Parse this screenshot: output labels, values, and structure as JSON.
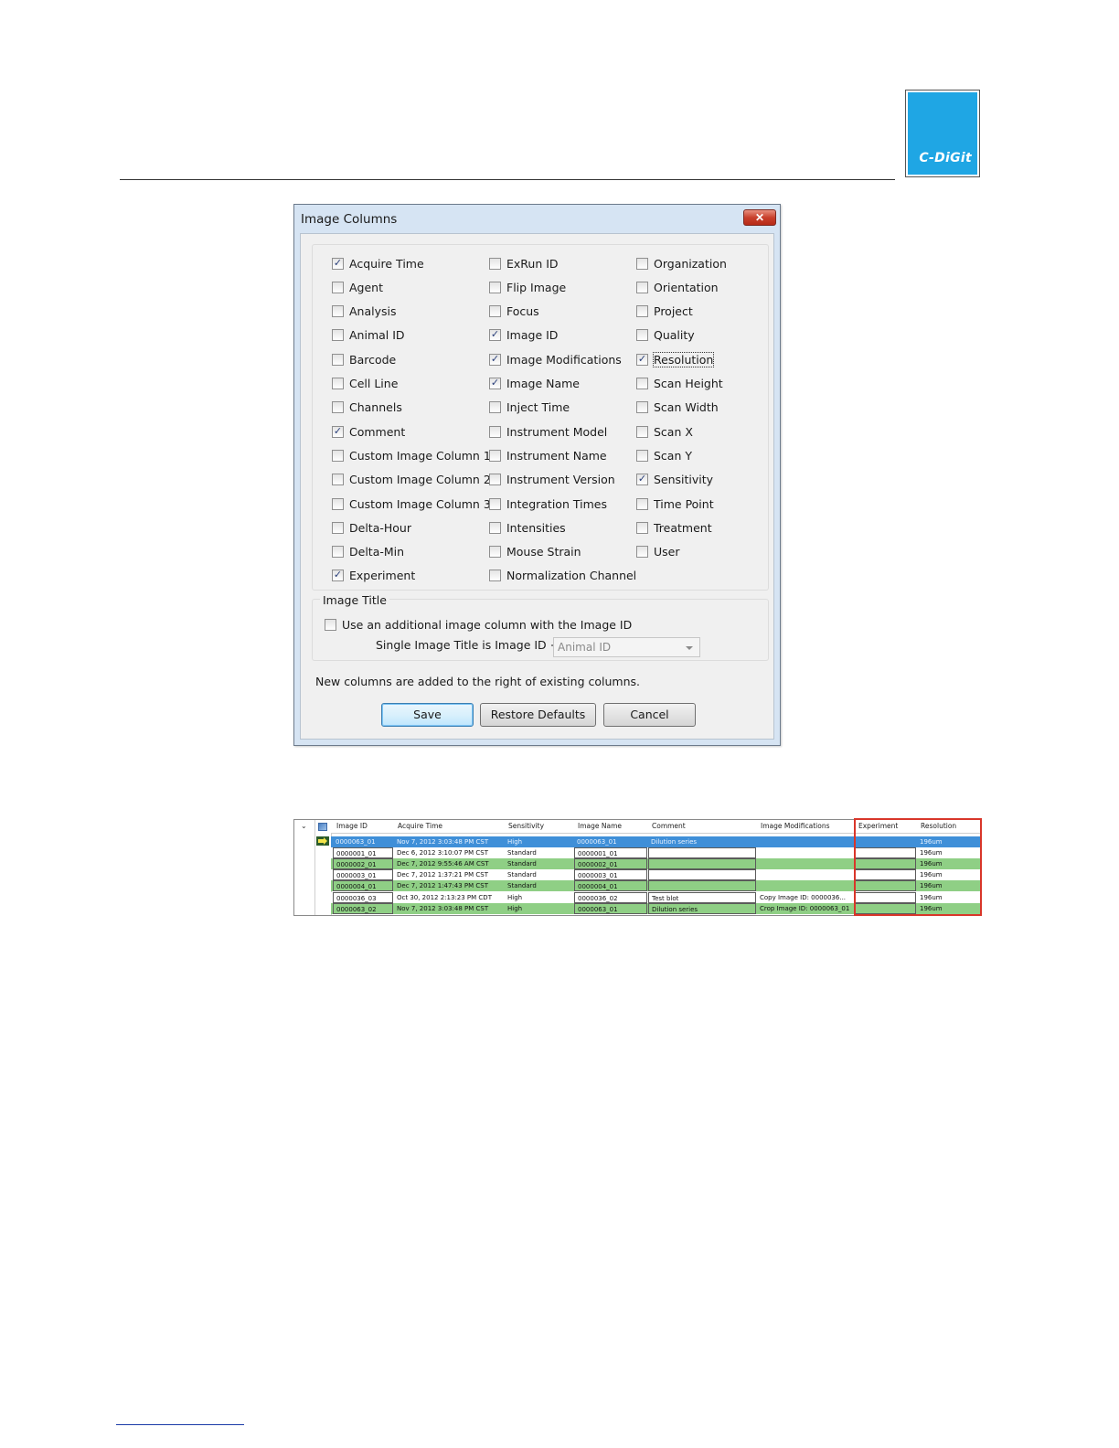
{
  "logo": {
    "text": "C-DiGit"
  },
  "dialog": {
    "title": "Image Columns",
    "close_label": "✕",
    "columns": [
      [
        {
          "label": "Acquire Time",
          "checked": true
        },
        {
          "label": "Agent",
          "checked": false
        },
        {
          "label": "Analysis",
          "checked": false
        },
        {
          "label": "Animal ID",
          "checked": false
        },
        {
          "label": "Barcode",
          "checked": false
        },
        {
          "label": "Cell Line",
          "checked": false
        },
        {
          "label": "Channels",
          "checked": false
        },
        {
          "label": "Comment",
          "checked": true
        },
        {
          "label": "Custom Image Column 1",
          "checked": false
        },
        {
          "label": "Custom Image Column 2",
          "checked": false
        },
        {
          "label": "Custom Image Column 3",
          "checked": false
        },
        {
          "label": "Delta-Hour",
          "checked": false
        },
        {
          "label": "Delta-Min",
          "checked": false
        },
        {
          "label": "Experiment",
          "checked": true
        }
      ],
      [
        {
          "label": "ExRun ID",
          "checked": false
        },
        {
          "label": "Flip Image",
          "checked": false
        },
        {
          "label": "Focus",
          "checked": false
        },
        {
          "label": "Image ID",
          "checked": true
        },
        {
          "label": "Image Modifications",
          "checked": true
        },
        {
          "label": "Image Name",
          "checked": true
        },
        {
          "label": "Inject Time",
          "checked": false
        },
        {
          "label": "Instrument Model",
          "checked": false
        },
        {
          "label": "Instrument Name",
          "checked": false
        },
        {
          "label": "Instrument Version",
          "checked": false
        },
        {
          "label": "Integration Times",
          "checked": false
        },
        {
          "label": "Intensities",
          "checked": false
        },
        {
          "label": "Mouse Strain",
          "checked": false
        },
        {
          "label": "Normalization Channel",
          "checked": false
        }
      ],
      [
        {
          "label": "Organization",
          "checked": false
        },
        {
          "label": "Orientation",
          "checked": false
        },
        {
          "label": "Project",
          "checked": false
        },
        {
          "label": "Quality",
          "checked": false
        },
        {
          "label": "Resolution",
          "checked": true,
          "focused": true
        },
        {
          "label": "Scan Height",
          "checked": false
        },
        {
          "label": "Scan Width",
          "checked": false
        },
        {
          "label": "Scan X",
          "checked": false
        },
        {
          "label": "Scan Y",
          "checked": false
        },
        {
          "label": "Sensitivity",
          "checked": true
        },
        {
          "label": "Time Point",
          "checked": false
        },
        {
          "label": "Treatment",
          "checked": false
        },
        {
          "label": "User",
          "checked": false
        }
      ]
    ],
    "image_title": {
      "legend": "Image Title",
      "additional_label": "Use an additional image column with the Image ID",
      "additional_checked": false,
      "single_label": "Single Image Title is Image ID +",
      "combo_value": "Animal ID"
    },
    "note": "New columns are added to the right of existing columns.",
    "buttons": {
      "save": "Save",
      "restore": "Restore Defaults",
      "cancel": "Cancel"
    }
  },
  "table": {
    "headers": [
      "Image ID",
      "Acquire Time",
      "Sensitivity",
      "Image Name",
      "Comment",
      "Image Modifications",
      "Experiment",
      "Resolution"
    ],
    "rows": [
      {
        "style": "sel",
        "cells": [
          "0000063_01",
          "Nov 7, 2012 3:03:48 PM CST",
          "High",
          "0000063_01",
          "Dilution series",
          "",
          "",
          "196um"
        ]
      },
      {
        "style": "white",
        "cells": [
          "0000001_01",
          "Dec 6, 2012 3:10:07 PM CST",
          "Standard",
          "0000001_01",
          "",
          "",
          "",
          "196um"
        ]
      },
      {
        "style": "green",
        "cells": [
          "0000002_01",
          "Dec 7, 2012 9:55:46 AM CST",
          "Standard",
          "0000002_01",
          "",
          "",
          "",
          "196um"
        ]
      },
      {
        "style": "white",
        "cells": [
          "0000003_01",
          "Dec 7, 2012 1:37:21 PM CST",
          "Standard",
          "0000003_01",
          "",
          "",
          "",
          "196um"
        ]
      },
      {
        "style": "green",
        "cells": [
          "0000004_01",
          "Dec 7, 2012 1:47:43 PM CST",
          "Standard",
          "0000004_01",
          "",
          "",
          "",
          "196um"
        ]
      },
      {
        "style": "white",
        "cells": [
          "0000036_03",
          "Oct 30, 2012 2:13:23 PM CDT",
          "High",
          "0000036_02",
          "Test blot",
          "Copy Image ID: 0000036...",
          "",
          "196um"
        ]
      },
      {
        "style": "green",
        "cells": [
          "0000063_02",
          "Nov 7, 2012 3:03:48 PM CST",
          "High",
          "0000063_01",
          "Dilution series",
          "Crop Image ID: 0000063_01",
          "",
          "196um"
        ]
      }
    ]
  }
}
